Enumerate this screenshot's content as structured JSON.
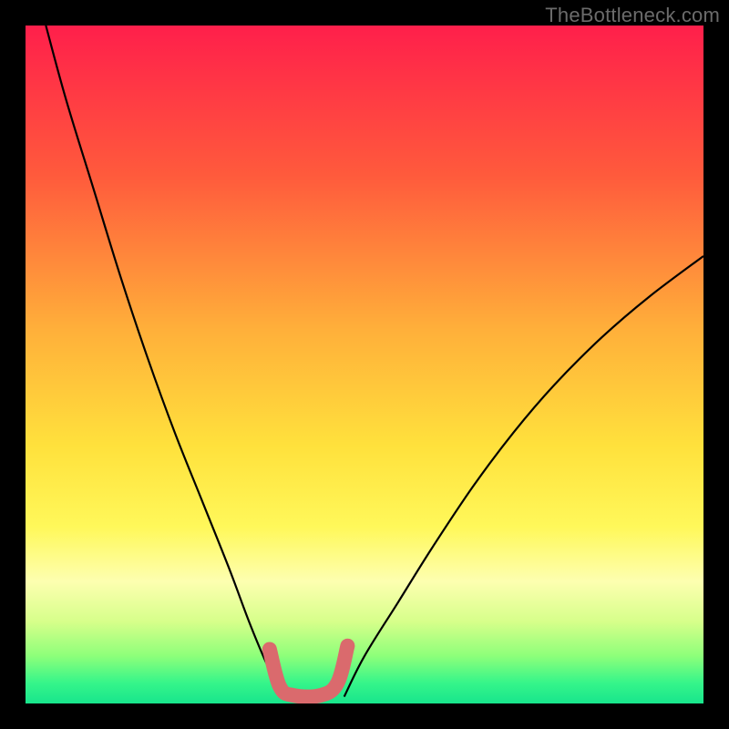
{
  "watermark": "TheBottleneck.com",
  "chart_data": {
    "type": "line",
    "title": "",
    "xlabel": "",
    "ylabel": "",
    "xlim": [
      0,
      100
    ],
    "ylim": [
      0,
      100
    ],
    "gradient_stops": [
      {
        "offset": 0,
        "color": "#ff1f4b"
      },
      {
        "offset": 22,
        "color": "#ff5a3c"
      },
      {
        "offset": 45,
        "color": "#ffb03a"
      },
      {
        "offset": 62,
        "color": "#ffe13c"
      },
      {
        "offset": 74,
        "color": "#fff85a"
      },
      {
        "offset": 82,
        "color": "#fdffb0"
      },
      {
        "offset": 88,
        "color": "#d6ff8a"
      },
      {
        "offset": 93,
        "color": "#8dff7a"
      },
      {
        "offset": 97,
        "color": "#35f58a"
      },
      {
        "offset": 100,
        "color": "#18e58c"
      }
    ],
    "series": [
      {
        "name": "left-descent",
        "type": "line",
        "stroke": "#000000",
        "width": 2.2,
        "x": [
          3,
          6,
          10,
          14,
          18,
          22,
          26,
          30,
          33,
          35.5,
          37.5
        ],
        "y": [
          100,
          89,
          76,
          63,
          51,
          40,
          30,
          20,
          12,
          6,
          2
        ]
      },
      {
        "name": "right-ascent",
        "type": "line",
        "stroke": "#000000",
        "width": 2.2,
        "x": [
          47,
          50,
          55,
          60,
          66,
          72,
          78,
          85,
          92,
          100
        ],
        "y": [
          1,
          7,
          15,
          23,
          32,
          40,
          47,
          54,
          60,
          66
        ]
      },
      {
        "name": "valley-marker",
        "type": "line",
        "stroke": "#da6a6d",
        "width": 16,
        "linecap": "round",
        "x": [
          36,
          37.5,
          39.5,
          43.5,
          46,
          47.5
        ],
        "y": [
          8,
          2.5,
          1.2,
          1.2,
          3,
          8.5
        ]
      }
    ]
  }
}
